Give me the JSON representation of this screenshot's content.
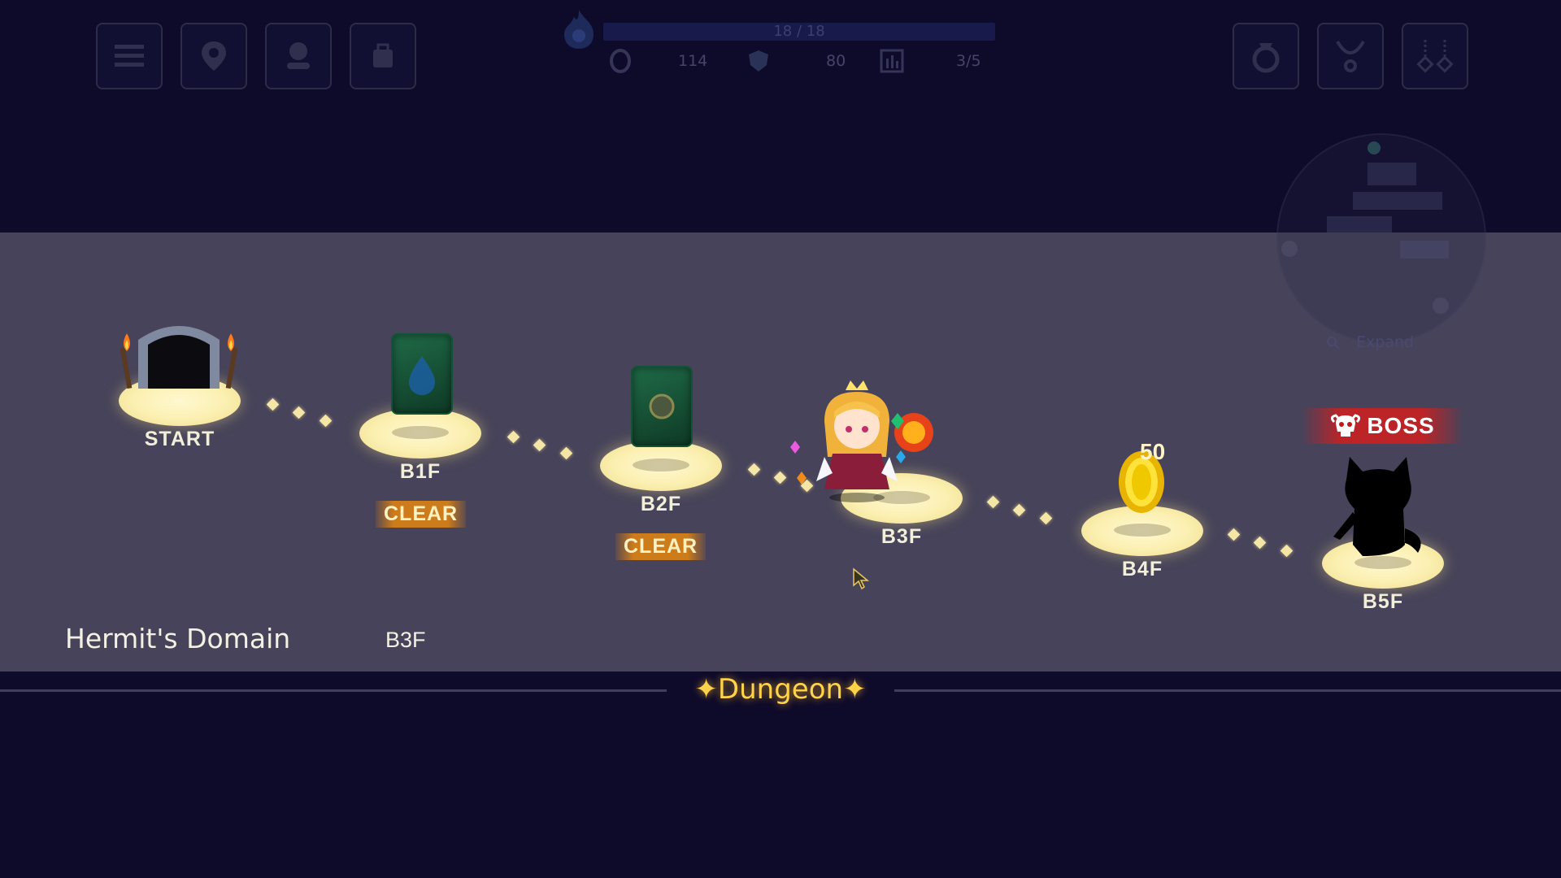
{
  "hud": {
    "hp": "18 / 18",
    "stat1": "114",
    "stat2": "80",
    "stat3": "3/5",
    "buttons_left": [
      "menu-icon",
      "map-pin-icon",
      "character-icon",
      "bag-icon"
    ],
    "buttons_right": [
      "ring-icon",
      "necklace-icon",
      "relic-icon"
    ]
  },
  "minimap": {
    "expand_label": "Expand"
  },
  "floors": [
    {
      "label": "START"
    },
    {
      "label": "B1F",
      "status": "CLEAR"
    },
    {
      "label": "B2F",
      "status": "CLEAR"
    },
    {
      "label": "B3F"
    },
    {
      "label": "B4F",
      "reward": "50"
    },
    {
      "label": "B5F",
      "badge": "BOSS"
    }
  ],
  "location": {
    "area": "Hermit's Domain",
    "floor": "B3F"
  },
  "footer": {
    "title": "Dungeon"
  },
  "colors": {
    "panel": "#46435a",
    "background": "#0e0a2a",
    "accent": "#ffd24a",
    "boss": "#d21e1e"
  }
}
